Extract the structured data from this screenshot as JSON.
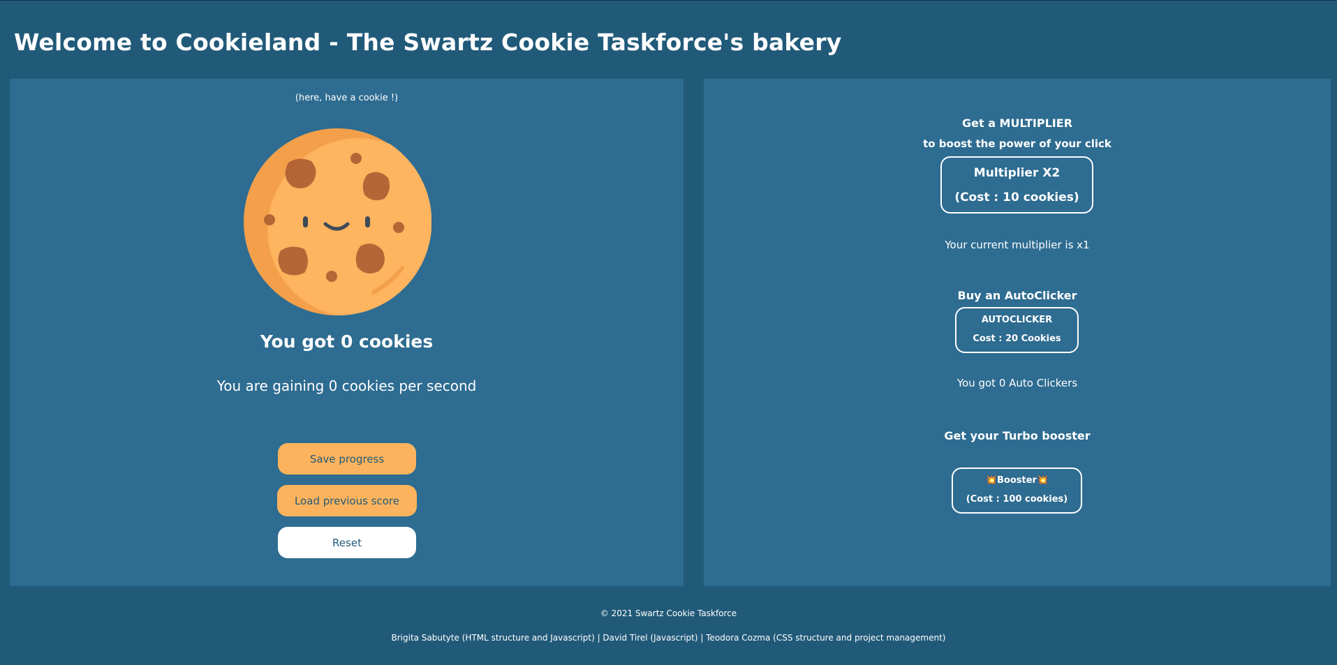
{
  "header": {
    "title": "Welcome to Cookieland - The Swartz Cookie Taskforce's bakery"
  },
  "cookie_panel": {
    "hint": "(here, have a cookie !)",
    "cookie_icon": "cookie-icon",
    "count_text": "You got 0 cookies",
    "rate_text": "You are gaining 0 cookies per second",
    "save_label": "Save progress",
    "load_label": "Load previous score",
    "reset_label": "Reset"
  },
  "shop": {
    "multiplier": {
      "title_line1": "Get a MULTIPLIER",
      "title_line2": "to boost the power of your click",
      "button_line1": "Multiplier X2",
      "button_line2": "(Cost : 10 cookies)",
      "status": "Your current multiplier is x1"
    },
    "autoclicker": {
      "title": "Buy an AutoClicker",
      "button_line1": "AUTOCLICKER",
      "button_line2": "Cost : 20 Cookies",
      "status": "You got 0 Auto Clickers"
    },
    "booster": {
      "title": "Get your Turbo booster",
      "button_line1": "💥Booster💥",
      "button_line2": "(Cost : 100 cookies)"
    }
  },
  "footer": {
    "copyright": "© 2021 Swartz Cookie Taskforce",
    "credits": "Brigita Sabutyte (HTML structure and Javascript) | David Tirel (Javascript) | Teodora Cozma (CSS structure and project management)"
  },
  "colors": {
    "background": "#215a79",
    "panel": "#2e6c91",
    "accent": "#fdb35d",
    "text": "#ffffff",
    "button_text": "#215a79"
  }
}
